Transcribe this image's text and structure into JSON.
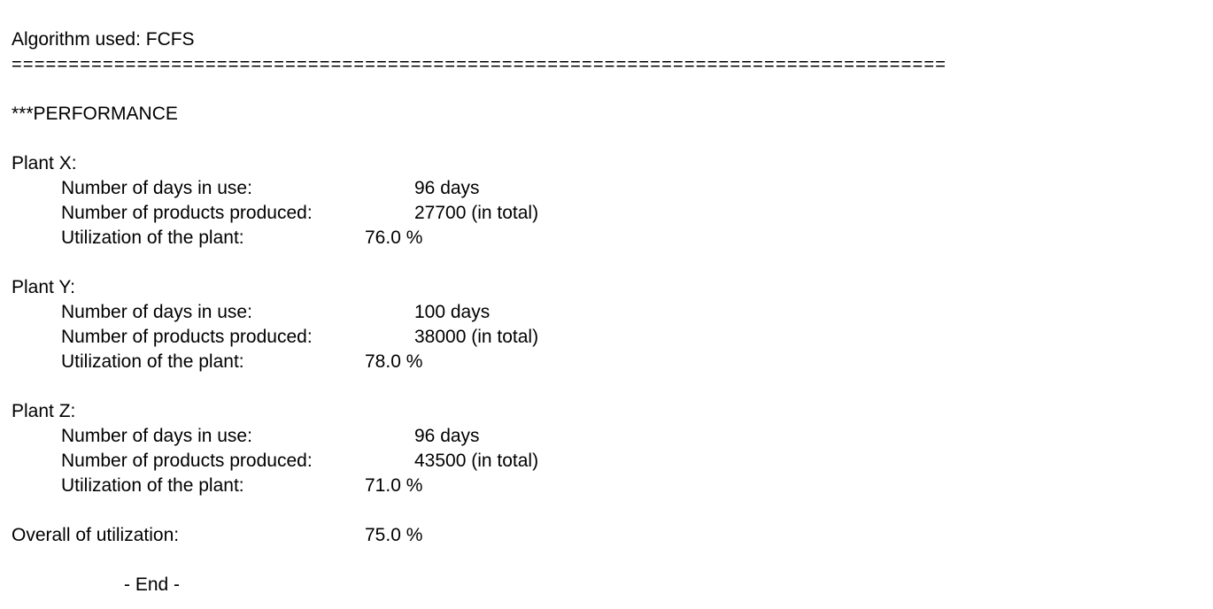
{
  "report": {
    "algorithm_line": "Algorithm used: FCFS",
    "separator": "==================================================================================",
    "section_title": "***PERFORMANCE",
    "plants": [
      {
        "name": "Plant X:",
        "days_label": "Number of days in use:",
        "days_value": "96 days",
        "products_label": "Number of products produced:",
        "products_value": "27700 (in total)",
        "util_label": "Utilization of the plant:",
        "util_value": "76.0 %"
      },
      {
        "name": "Plant Y:",
        "days_label": "Number of days in use:",
        "days_value": "100 days",
        "products_label": "Number of products produced:",
        "products_value": "38000 (in total)",
        "util_label": "Utilization of the plant:",
        "util_value": "78.0 %"
      },
      {
        "name": "Plant Z:",
        "days_label": "Number of days in use:",
        "days_value": "96 days",
        "products_label": "Number of products produced:",
        "products_value": "43500 (in total)",
        "util_label": "Utilization of the plant:",
        "util_value": "71.0 %"
      }
    ],
    "overall_label": "Overall of utilization:",
    "overall_value": "75.0 %",
    "end_text": "- End -"
  }
}
